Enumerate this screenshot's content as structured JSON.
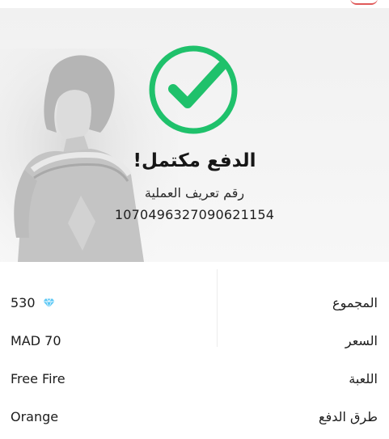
{
  "status": {
    "title": "الدفع مكتمل!",
    "transaction_label": "رقم تعريف العملية",
    "transaction_id": "1070496327090621154"
  },
  "details": [
    {
      "label": "المجموع",
      "value": "530",
      "icon": "diamond-icon"
    },
    {
      "label": "السعر",
      "value": "MAD 70"
    },
    {
      "label": "اللعبة",
      "value": "Free Fire"
    },
    {
      "label": "طرق الدفع",
      "value": "Orange"
    }
  ],
  "colors": {
    "success_green": "#1fc16b",
    "diamond_blue": "#5cc8f5"
  }
}
